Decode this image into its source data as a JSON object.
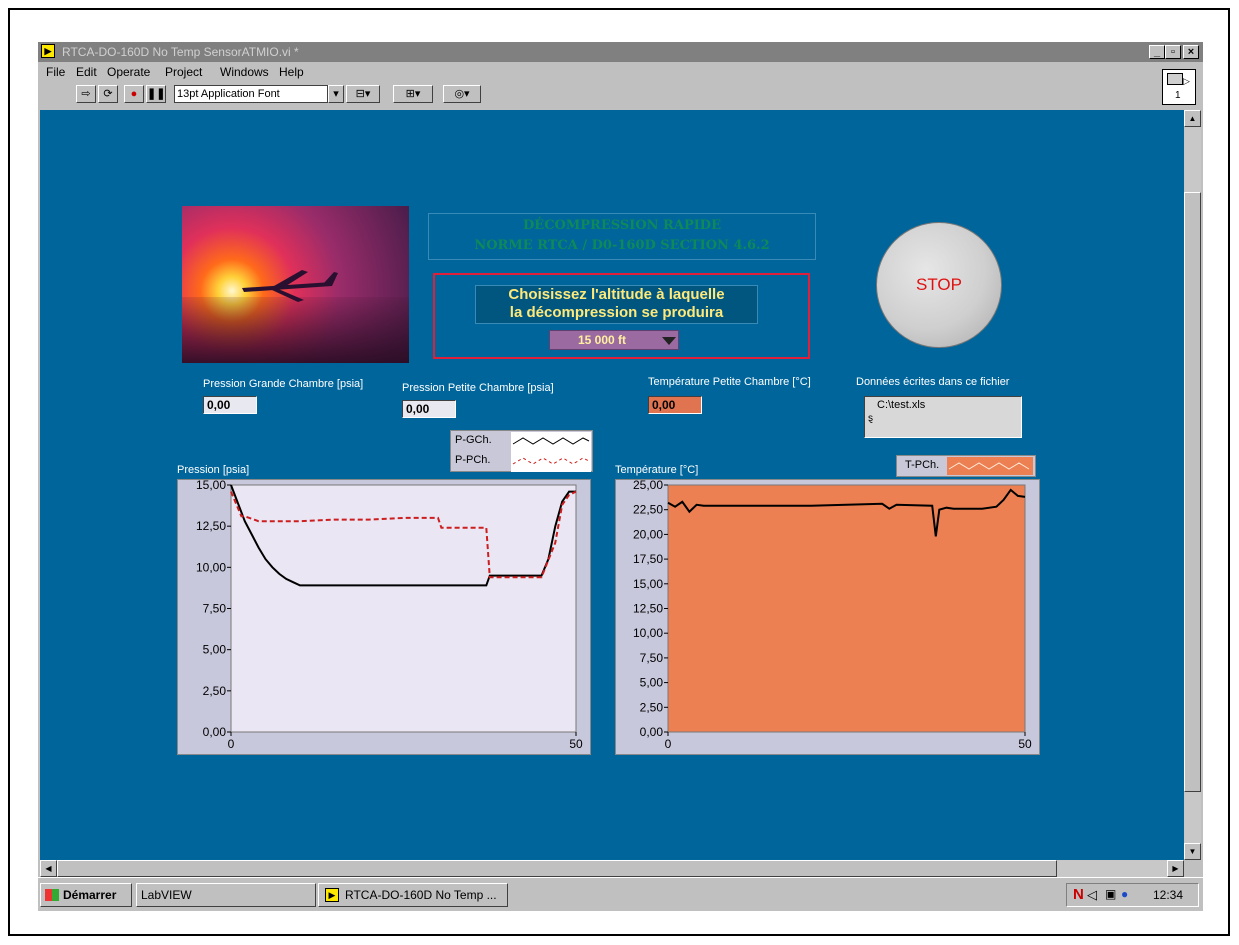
{
  "window": {
    "title": "RTCA-DO-160D No Temp SensorATMIO.vi *",
    "controls": {
      "minimize": "_",
      "restore": "̸",
      "close": "×"
    }
  },
  "menu": [
    "File",
    "Edit",
    "Operate",
    "Project",
    "Windows",
    "Help"
  ],
  "toolbar": {
    "font": "13pt Application Font"
  },
  "connector": {
    "number": "1"
  },
  "panel": {
    "title_line1": "DÉCOMPRESSION RAPIDE",
    "title_line2": "NORME RTCA / D0-160D  SECTION 4.6.2",
    "altitude": {
      "label_line1": "Choisissez l'altitude à laquelle",
      "label_line2": "la décompression se produira",
      "value": "15 000 ft"
    },
    "stop_label": "STOP",
    "indicators": [
      {
        "label": "Pression Grande Chambre [psia]",
        "value": "0,00"
      },
      {
        "label": "Pression Petite Chambre [psia]",
        "value": "0,00"
      },
      {
        "label": "Température Petite Chambre [°C]",
        "value": "0,00"
      }
    ],
    "file": {
      "label": "Données écrites dans ce fichier",
      "value": "C:\\test.xls"
    }
  },
  "legends": {
    "pressure": [
      "P-GCh.",
      "P-PCh."
    ],
    "temperature": [
      "T-PCh."
    ]
  },
  "colors": {
    "panel_bg": "#00659b",
    "pressure_plot_bg": "#ebe6f3",
    "temp_plot_bg": "#ec8052",
    "p_gch": "#000000",
    "p_pch": "#cc1e1e",
    "temp_indicator": "#e07450",
    "stop_text": "#e01010"
  },
  "chart_data": [
    {
      "type": "line",
      "title": "Pression [psia]",
      "xlim": [
        0,
        50
      ],
      "ylim": [
        0,
        15
      ],
      "x_ticks": [
        "0",
        "50"
      ],
      "y_ticks": [
        "15,00",
        "12,50",
        "10,00",
        "7,50",
        "5,00",
        "2,50",
        "0,00"
      ],
      "series": [
        {
          "name": "P-GCh.",
          "x": [
            0,
            1,
            2,
            3,
            4,
            5,
            6,
            7,
            8,
            9,
            10,
            12,
            15,
            20,
            25,
            30,
            35,
            37,
            37.5,
            38,
            40,
            45,
            46,
            47,
            48,
            49,
            49.5,
            50
          ],
          "y": [
            15,
            13.9,
            12.8,
            12,
            11.2,
            10.5,
            10,
            9.6,
            9.3,
            9.1,
            8.9,
            8.9,
            8.9,
            8.9,
            8.9,
            8.9,
            8.9,
            8.9,
            9.5,
            9.5,
            9.5,
            9.5,
            10.5,
            12.5,
            14,
            14.6,
            14.6,
            14.6
          ]
        },
        {
          "name": "P-PCh.",
          "x": [
            0,
            1.5,
            2,
            4,
            10,
            15,
            20,
            25,
            30,
            30.5,
            32,
            37,
            37.5,
            38,
            45,
            47,
            48,
            49,
            50
          ],
          "y": [
            14.6,
            13.1,
            13.1,
            12.8,
            12.8,
            12.9,
            12.9,
            13,
            13,
            12.4,
            12.4,
            12.4,
            9.4,
            9.4,
            9.4,
            11.5,
            13.8,
            14.4,
            14.6
          ]
        }
      ]
    },
    {
      "type": "line",
      "title": "Température [°C]",
      "xlim": [
        0,
        50
      ],
      "ylim": [
        0,
        25
      ],
      "x_ticks": [
        "0",
        "50"
      ],
      "y_ticks": [
        "25,00",
        "22,50",
        "20,00",
        "17,50",
        "15,00",
        "12,50",
        "10,00",
        "7,50",
        "5,00",
        "2,50",
        "0,00"
      ],
      "series": [
        {
          "name": "T-PCh.",
          "x": [
            0,
            1,
            2,
            3,
            4,
            5,
            8,
            15,
            20,
            25,
            30,
            31,
            32,
            37,
            37.5,
            38,
            39,
            40,
            44,
            46,
            47,
            48,
            49,
            50
          ],
          "y": [
            23.2,
            22.8,
            23.3,
            22.3,
            23,
            22.9,
            22.9,
            22.9,
            22.9,
            23,
            23.1,
            22.6,
            23,
            22.9,
            19.8,
            22.5,
            22.7,
            22.6,
            22.6,
            22.8,
            23.5,
            24.5,
            23.9,
            23.8
          ]
        }
      ]
    }
  ],
  "taskbar": {
    "start": "Démarrer",
    "items": [
      "LabVIEW",
      "RTCA-DO-160D No Temp ..."
    ],
    "clock": "12:34"
  }
}
